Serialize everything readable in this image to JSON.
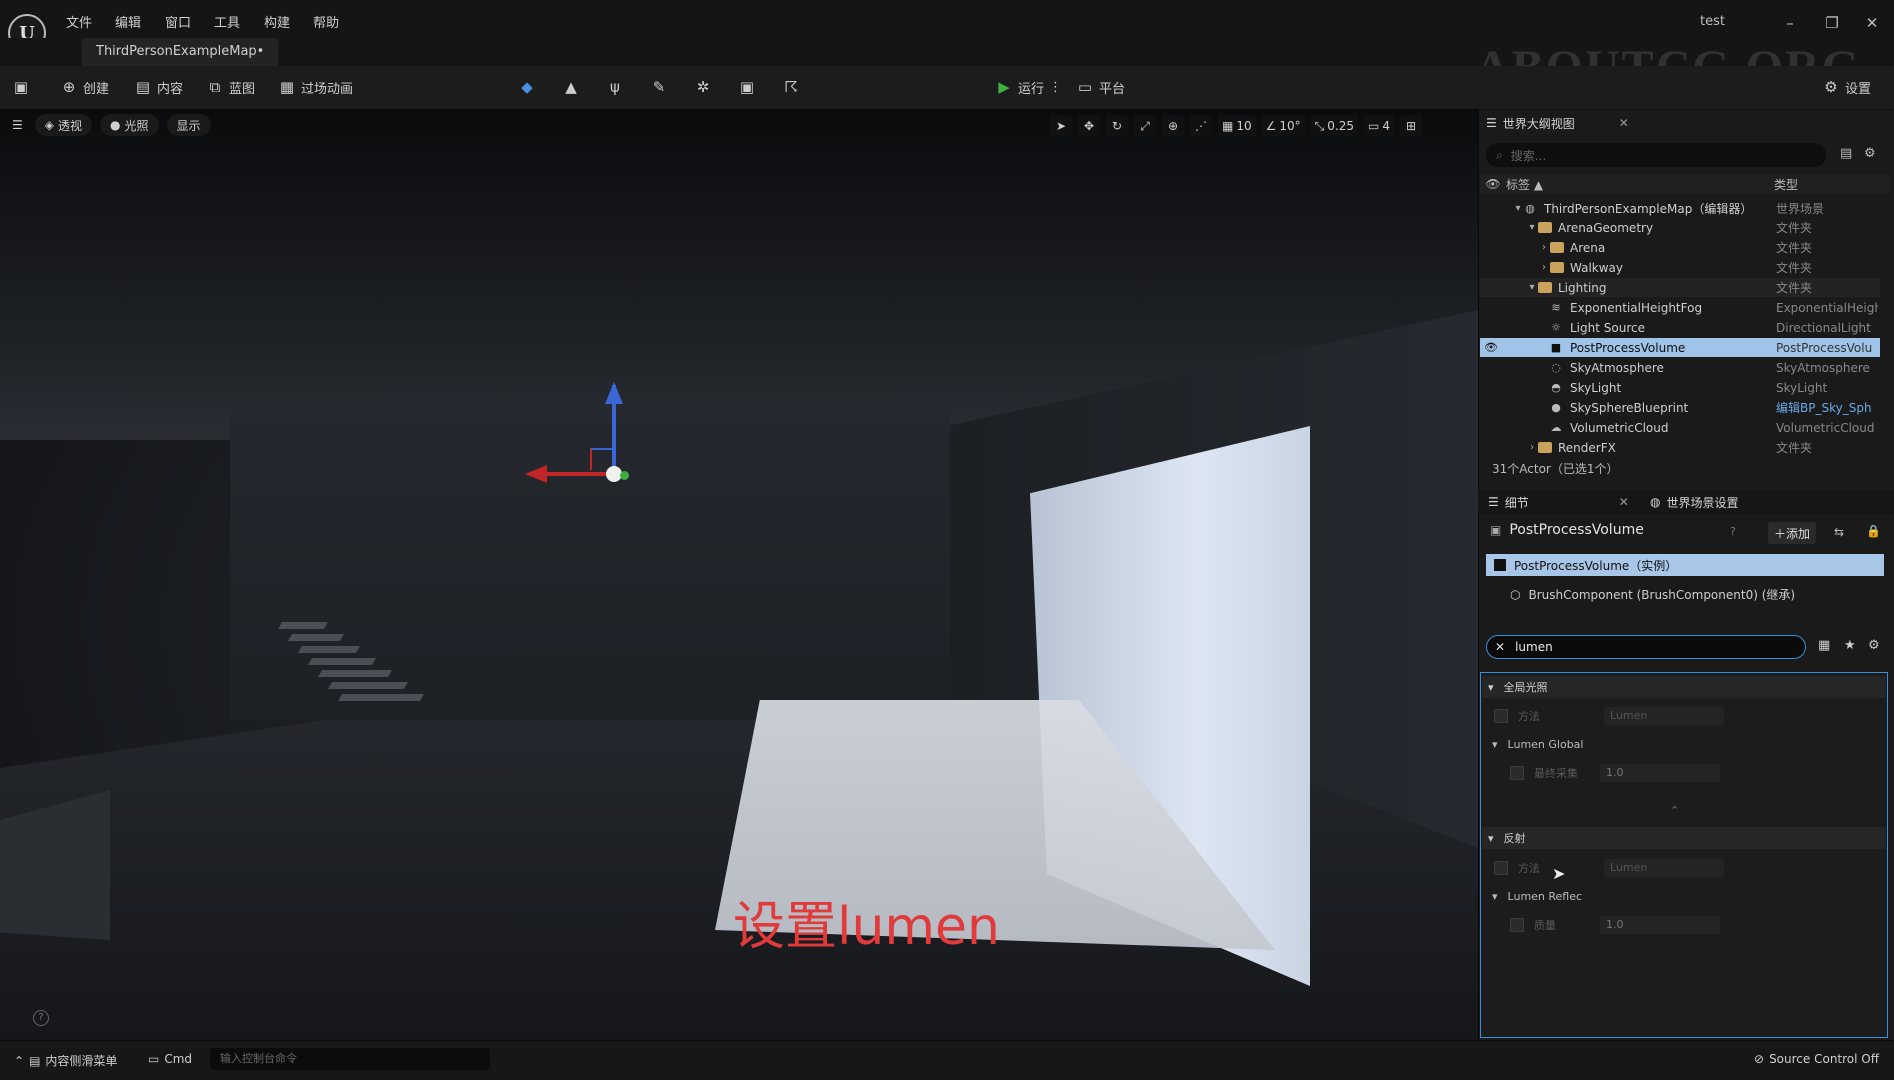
{
  "menu": {
    "items": [
      "文件",
      "编辑",
      "窗口",
      "工具",
      "构建",
      "帮助"
    ],
    "project": "test",
    "logo": "U"
  },
  "tab": {
    "map": "ThirdPersonExampleMap•"
  },
  "watermark": "ABOUTCG.ORG",
  "toolbar": {
    "create": "创建",
    "content": "内容",
    "blueprint": "蓝图",
    "cinematics": "过场动画",
    "play": "运行",
    "platforms": "平台",
    "settings": "设置"
  },
  "viewport": {
    "perspective": "透视",
    "lit": "光照",
    "show": "显示",
    "grid_snap": "10",
    "rot_snap": "10°",
    "scale_snap": "0.25",
    "camera_speed": "4",
    "caption": "设置lumen"
  },
  "outliner": {
    "title": "世界大纲视图",
    "search_placeholder": "搜索...",
    "col_label": "标签 ▲",
    "col_type": "类型",
    "rows": [
      {
        "label": "ThirdPersonExampleMap（编辑器）",
        "type": "世界场景"
      },
      {
        "label": "ArenaGeometry",
        "type": "文件夹"
      },
      {
        "label": "Arena",
        "type": "文件夹"
      },
      {
        "label": "Walkway",
        "type": "文件夹"
      },
      {
        "label": "Lighting",
        "type": "文件夹"
      },
      {
        "label": "ExponentialHeightFog",
        "type": "ExponentialHeigh"
      },
      {
        "label": "Light Source",
        "type": "DirectionalLight"
      },
      {
        "label": "PostProcessVolume",
        "type": "PostProcessVolu"
      },
      {
        "label": "SkyAtmosphere",
        "type": "SkyAtmosphere"
      },
      {
        "label": "SkyLight",
        "type": "SkyLight"
      },
      {
        "label": "SkySphereBlueprint",
        "type": "编辑BP_Sky_Sph"
      },
      {
        "label": "VolumetricCloud",
        "type": "VolumetricCloud"
      },
      {
        "label": "RenderFX",
        "type": "文件夹"
      }
    ],
    "actor_count": "31个Actor（已选1个）"
  },
  "details": {
    "tab_details": "细节",
    "tab_world": "世界场景设置",
    "title": "PostProcessVolume",
    "add": "添加",
    "component_instance": "PostProcessVolume（实例）",
    "component_brush": "BrushComponent (BrushComponent0) (继承)",
    "filter": "lumen",
    "sections": {
      "gi": "全局光照",
      "gi_method": "方法",
      "gi_method_val": "Lumen",
      "lumen_global": "Lumen Global",
      "final_gather": "最终采集",
      "final_gather_val": "1.0",
      "reflections": "反射",
      "refl_method": "方法",
      "refl_method_val": "Lumen",
      "lumen_reflec": "Lumen Reflec",
      "quality": "质量",
      "quality_val": "1.0"
    }
  },
  "statusbar": {
    "content_drawer": "内容侧滑菜单",
    "cmd": "Cmd",
    "cmd_placeholder": "输入控制台命令",
    "source_control": "Source Control Off"
  },
  "colors": {
    "accent": "#3a8fd8",
    "selection": "#a0c3e8",
    "caption": "#e03a3a",
    "play": "#3fae3f"
  }
}
